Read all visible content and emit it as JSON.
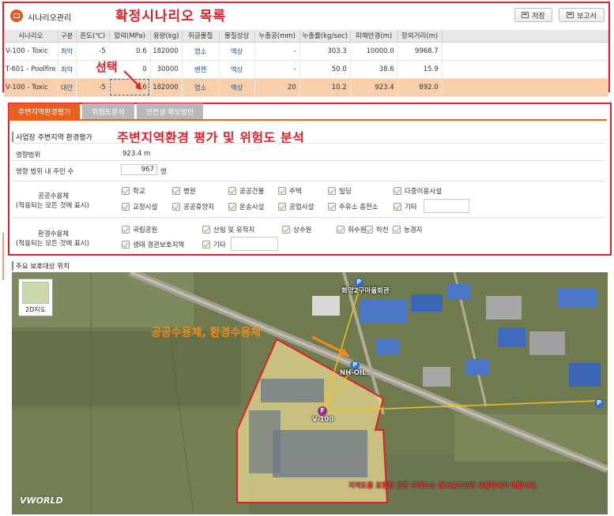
{
  "header": {
    "title": "시나리오관리",
    "save_label": "저장",
    "report_label": "보고서",
    "list_overlay": "확정시나리오 목록",
    "select_overlay": "선택"
  },
  "table": {
    "columns": [
      "시나리오",
      "구분",
      "온도(℃)",
      "압력(MPa)",
      "용량(kg)",
      "취급물질",
      "물질성상",
      "누출공(mm)",
      "누출률(kg/sec)",
      "피해반경(m)",
      "장외거리(m)"
    ],
    "rows": [
      [
        "V-100 - Toxic",
        "최악",
        "-5",
        "0.6",
        "182000",
        "염소",
        "액상",
        "-",
        "303.3",
        "10000.0",
        "9968.7"
      ],
      [
        "T-601 - Poolfire",
        "최악",
        "0",
        "0",
        "30000",
        "벤젠",
        "액상",
        "-",
        "50.0",
        "38.6",
        "15.9"
      ],
      [
        "V-100 - Toxic",
        "대안",
        "-5",
        "0.6",
        "182000",
        "염소",
        "액상",
        "20",
        "10.2",
        "923.4",
        "892.0"
      ]
    ],
    "selected_row": 2
  },
  "tabs": [
    {
      "label": "주변지역환경평가",
      "active": true
    },
    {
      "label": "위험도분석",
      "active": false
    },
    {
      "label": "안전성 확보방안",
      "active": false
    }
  ],
  "env": {
    "overlay": "주변지역환경 평가 및 위험도 분석",
    "section_title": "사업장 주변지역 환경평가",
    "impact_range_label": "영향범위",
    "impact_range_value": "923.4 m",
    "residents_label": "영향 범위 내 주민 수",
    "residents_value": "967",
    "residents_unit": "명",
    "public_label_1": "공공수용체",
    "public_label_2": "(적용되는 모든 것에 표시)",
    "public_options": [
      "학교",
      "병원",
      "공공건물",
      "주택",
      "빌딩",
      "다중이용시설",
      "교정시설",
      "공공휴양지",
      "운송시설",
      "공업시설",
      "주유소 충전소",
      "기타"
    ],
    "enviro_label_1": "환경수용체",
    "enviro_label_2": "(적용되는 모든 것에 표시)",
    "enviro_options": [
      "국립공원",
      "산림 및 유적지",
      "상수원",
      "취수원",
      "하천",
      "농경지",
      "생태 경관보호지역",
      "기타"
    ]
  },
  "map": {
    "title": "주요 보호대상 위치",
    "btn_2d": "2D지도",
    "overlay": "공공수용체, 환경수용체",
    "poi_1": "화양2구마을회관",
    "poi_2": "NH-OIL",
    "poi_3": "V-100",
    "disclaimer": "지적도를 포함한 모든 주제도는 참고용으로만 사용하시기 바랍니다.",
    "logo": "VWORLD"
  },
  "colors": {
    "accent": "#e8601d",
    "highlight": "#e0202a",
    "selected_row": "#f9cfab"
  }
}
